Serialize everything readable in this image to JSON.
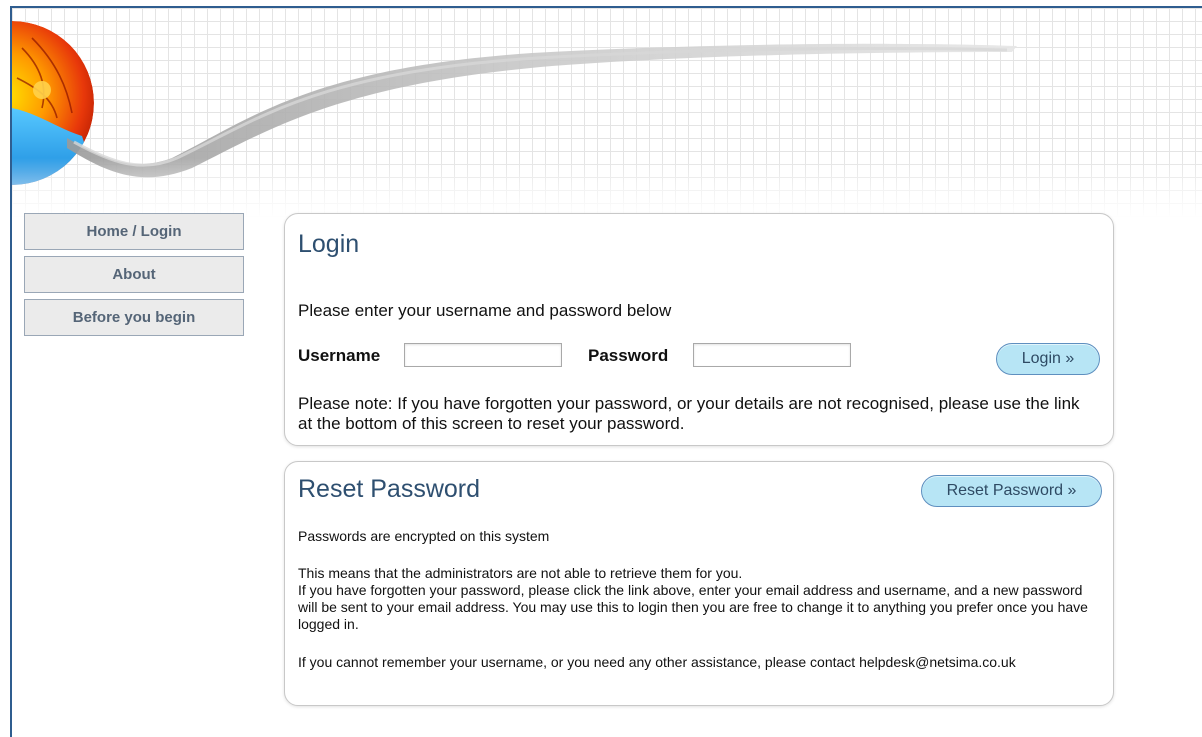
{
  "nav": {
    "items": [
      {
        "label": "Home / Login"
      },
      {
        "label": "About"
      },
      {
        "label": "Before you begin"
      }
    ]
  },
  "login": {
    "title": "Login",
    "intro": "Please enter your username and password below",
    "username_label": "Username",
    "username_value": "",
    "password_label": "Password",
    "password_value": "",
    "button_label": "Login »",
    "note": "Please note: If you have forgotten your password, or your details are not recognised, please use the link at the bottom of this screen to reset your password."
  },
  "reset": {
    "title": "Reset Password",
    "button_label": "Reset Password »",
    "encrypted": "Passwords are encrypted on this system",
    "admins": "This means that the administrators are not able to retrieve them for you.",
    "forgotten": "If you have forgotten your password, please click the link above, enter your email address and username, and a new password will be sent to your email address. You may use this to login then you are free to change it to anything you prefer once you have logged in.",
    "contact": "If you cannot remember your username, or you need any other assistance, please contact helpdesk@netsima.co.uk"
  },
  "colors": {
    "frame": "#2f5d8f",
    "heading": "#2e4f70",
    "button_fill": "#b7e5f5",
    "button_border": "#5e8fbf",
    "nav_text": "#556577"
  },
  "icons": {
    "logo": "retina-eye-logo",
    "banner": "swoosh-graphic"
  }
}
